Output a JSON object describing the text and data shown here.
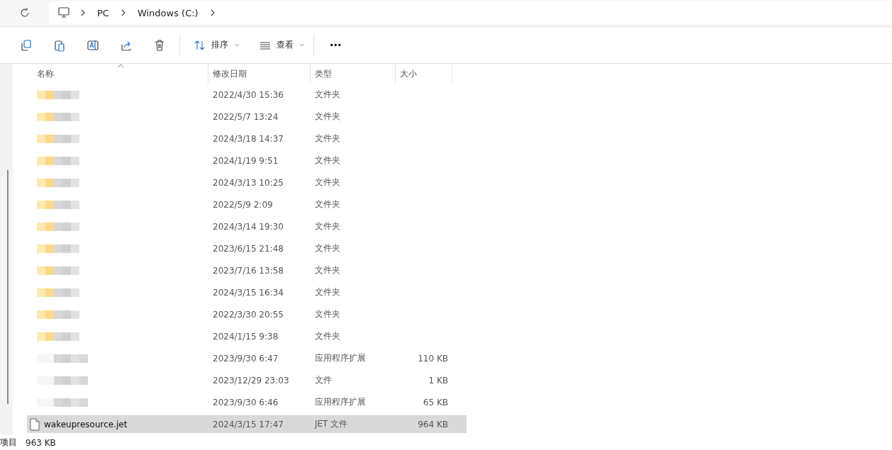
{
  "breadcrumb": [
    "PC",
    "Windows (C:)"
  ],
  "toolbar": {
    "sort": "排序",
    "view": "查看",
    "more": "⋯"
  },
  "columns": [
    {
      "label": "名称",
      "sorted": true
    },
    {
      "label": "修改日期",
      "sorted": false
    },
    {
      "label": "类型",
      "sorted": false
    },
    {
      "label": "大小",
      "sorted": false
    }
  ],
  "rows": [
    {
      "kind": "folder",
      "date": "2022/4/30 15:36",
      "type": "文件夹",
      "selected": false
    },
    {
      "kind": "folder",
      "date": "2022/5/7 13:24",
      "type": "文件夹",
      "selected": false
    },
    {
      "kind": "folder",
      "date": "2024/3/18 14:37",
      "type": "文件夹",
      "selected": false
    },
    {
      "kind": "folder",
      "date": "2024/1/19 9:51",
      "type": "文件夹",
      "selected": false
    },
    {
      "kind": "folder",
      "date": "2024/3/13 10:25",
      "type": "文件夹",
      "selected": false
    },
    {
      "kind": "folder",
      "date": "2022/5/9 2:09",
      "type": "文件夹",
      "selected": false
    },
    {
      "kind": "folder",
      "date": "2024/3/14 19:30",
      "type": "文件夹",
      "selected": false
    },
    {
      "kind": "folder",
      "date": "2023/6/15 21:48",
      "type": "文件夹",
      "selected": false
    },
    {
      "kind": "folder",
      "date": "2023/7/16 13:58",
      "type": "文件夹",
      "selected": false
    },
    {
      "kind": "folder",
      "date": "2024/3/15 16:34",
      "type": "文件夹",
      "selected": false
    },
    {
      "kind": "folder",
      "date": "2022/3/30 20:55",
      "type": "文件夹",
      "selected": false
    },
    {
      "kind": "folder",
      "date": "2024/1/15 9:38",
      "type": "文件夹",
      "selected": false
    },
    {
      "kind": "redacted",
      "date": "2023/9/30 6:47",
      "type": "应用程序扩展",
      "size": "110 KB",
      "selected": false
    },
    {
      "kind": "redacted",
      "date": "2023/12/29 23:03",
      "type": "文件",
      "size": "1 KB",
      "selected": false
    },
    {
      "kind": "redacted",
      "date": "2023/9/30 6:46",
      "type": "应用程序扩展",
      "size": "65 KB",
      "selected": false
    },
    {
      "kind": "file",
      "name": "wakeupresource.jet",
      "date": "2024/3/15 17:47",
      "type": "JET 文件",
      "size": "964 KB",
      "selected": true
    }
  ],
  "status_bar": {
    "items": "项目",
    "size": "963 KB"
  }
}
